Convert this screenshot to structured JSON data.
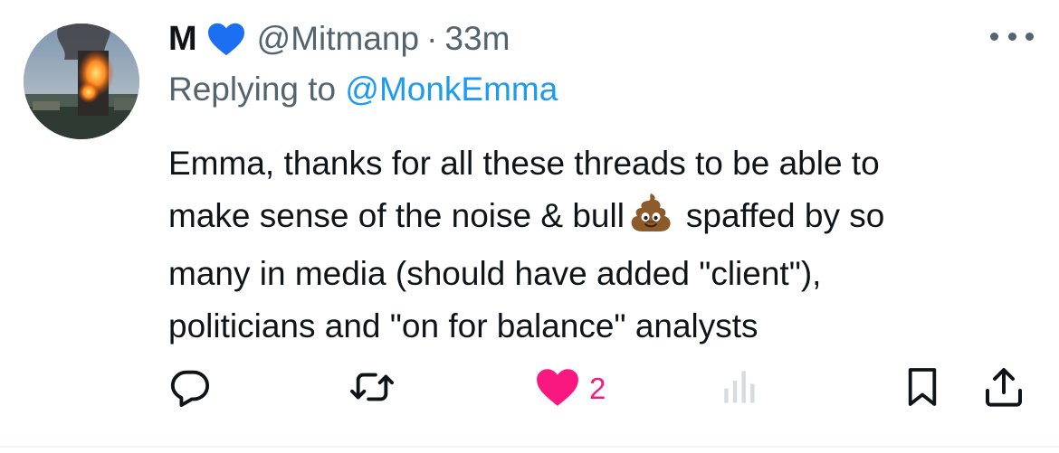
{
  "tweet": {
    "author": {
      "display_name": "M",
      "badge_icon": "blue-heart-icon",
      "handle": "@Mitmanp",
      "separator": "·",
      "time": "33m"
    },
    "replying": {
      "prefix": "Replying to ",
      "mention": "@MonkEmma"
    },
    "body_lines": [
      "Emma, thanks for all these threads to be able to",
      "make sense of the noise & bull",
      "spaffed by so",
      "many in media (should have added \"client\"),",
      "politicians and \"on for balance\" analysts"
    ],
    "emoji_icon": "pile-of-poo-icon",
    "actions": {
      "reply_icon": "reply-icon",
      "retweet_icon": "retweet-icon",
      "like_icon": "heart-filled-icon",
      "like_count": "2",
      "views_icon": "views-chart-icon",
      "bookmark_icon": "bookmark-icon",
      "share_icon": "share-icon"
    },
    "colors": {
      "text": "#0f1419",
      "secondary": "#536471",
      "link": "#1d9bf0",
      "like": "#f91880",
      "badge": "#1d6ff2"
    }
  }
}
